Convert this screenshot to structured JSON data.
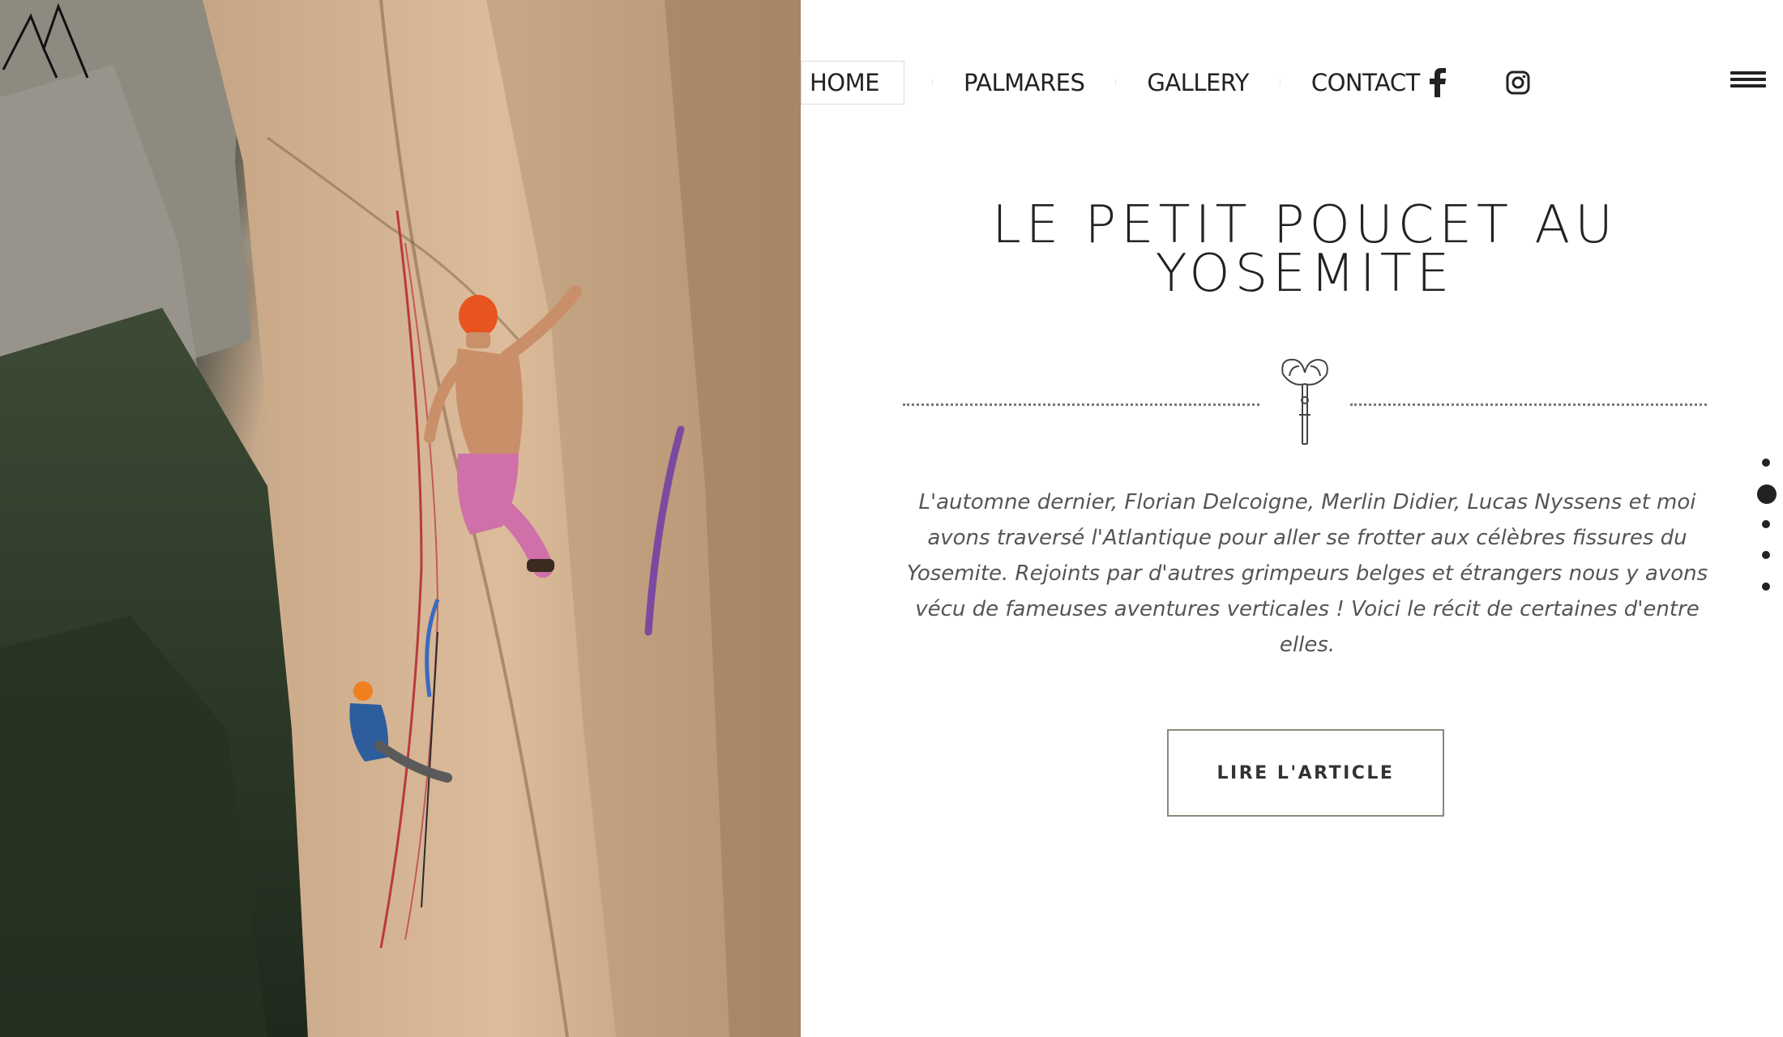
{
  "hero": {
    "alt": "Rock climber with orange helmet on Yosemite granite wall, belayer below",
    "logo_icon": "mountain-logo-icon"
  },
  "nav": {
    "items": [
      {
        "label": "HOME",
        "active": true
      },
      {
        "label": "PALMARES"
      },
      {
        "label": "GALLERY"
      },
      {
        "label": "CONTACT"
      }
    ],
    "social": [
      {
        "icon": "facebook-icon"
      },
      {
        "icon": "instagram-icon"
      }
    ],
    "menu_icon": "hamburger-menu-icon"
  },
  "article": {
    "title": "LE PETIT POUCET AU YOSEMITE",
    "divider_icon": "climbing-cam-icon",
    "intro": "L'automne dernier, Florian Delcoigne, Merlin Didier, Lucas Nyssens et moi avons traversé l'Atlantique pour aller se frotter aux célèbres fissures du Yosemite. Rejoints par d'autres grimpeurs belges et étrangers nous y avons vécu de fameuses aventures verticales ! Voici le récit de certaines d'entre elles.",
    "cta_label": "LIRE L'ARTICLE"
  },
  "pagination": {
    "count": 5,
    "active_index": 1
  },
  "colors": {
    "text": "#222222",
    "body_text": "#555555",
    "button_border": "#8a8a7a",
    "helmet": "#e8541f"
  }
}
